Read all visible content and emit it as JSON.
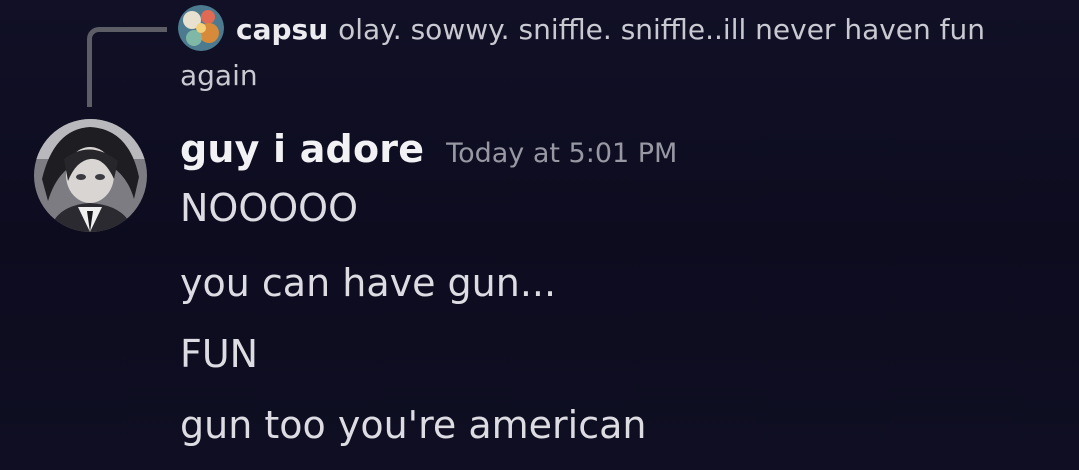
{
  "reply": {
    "author": "capsu",
    "text": "olay. sowwy. sniffle. sniffle..ill never haven fun again",
    "avatar_icon": "reply-avatar-icon"
  },
  "message": {
    "author": "guy i adore",
    "timestamp": "Today at 5:01 PM",
    "avatar_icon": "author-avatar-icon",
    "lines": [
      "NOOOOO",
      "you can have gun...",
      "FUN",
      "gun too you're american"
    ]
  },
  "colors": {
    "background": "#0f0e22",
    "username": "#f2f2f5",
    "message_text": "#dcdce2",
    "timestamp": "#9798a3",
    "reply_spine": "#5d5d66"
  }
}
